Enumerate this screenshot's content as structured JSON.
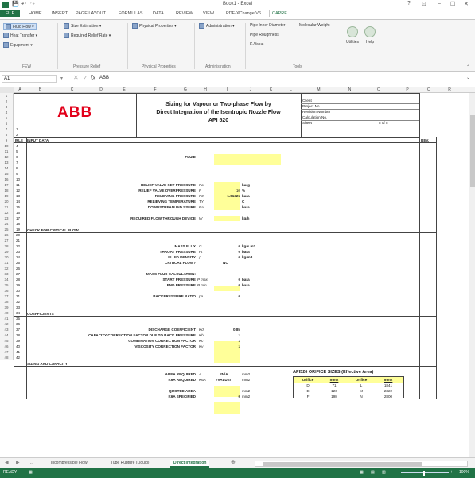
{
  "window": {
    "title": "Book1 - Excel",
    "controls": [
      "?",
      "⊡",
      "–",
      "☐",
      "✕"
    ]
  },
  "ribbon_tabs": [
    "FILE",
    "HOME",
    "INSERT",
    "PAGE LAYOUT",
    "FORMULAS",
    "DATA",
    "REVIEW",
    "VIEW",
    "PDF-XChange V6",
    "CAPRE"
  ],
  "ribbon": {
    "fluid_flow": "Fluid Flow ▾",
    "heat_transfer": "Heat Transfer ▾",
    "equipment": "Equipment ▾",
    "group_few": "FEW",
    "size_estimation": "Size Estimation ▾",
    "required_relief_rate": "Required Relief Rate ▾",
    "group_pressure_relief": "Pressure Relief",
    "physical_properties": "Physical Properties ▾",
    "group_physical_properties": "Physical Properties",
    "administration": "Administration ▾",
    "group_administration": "Administration",
    "pipe_inner_diameter": "Pipe Inner Diameter",
    "molecular_weight": "Molecular Weight",
    "pipe_roughness": "Pipe Roughness",
    "k_value": "K-Value",
    "group_tools": "Tools",
    "utilities": "Utilities",
    "help": "Help"
  },
  "formula_bar": {
    "name_box": "A1",
    "value": "ABB"
  },
  "columns": [
    "A",
    "B",
    "C",
    "D",
    "E",
    "F",
    "G",
    "H",
    "I",
    "J",
    "K",
    "L",
    "M",
    "N",
    "O",
    "P",
    "Q",
    "R"
  ],
  "header_block": {
    "logo": "ABB",
    "title1": "Sizing for Vapour or Two-phase Flow by",
    "title2": "Direct Integration of the Isentropic Nozzle Flow",
    "title3": "API 520",
    "client": "Client",
    "project": "Project No.",
    "revision": "Revision Number",
    "calc": "Calculation No.",
    "sheet": "Sheet",
    "sheet_val": "5 of 5"
  },
  "sheet": {
    "file": "FILE",
    "input_data": "INPUT DATA",
    "rev": "REV.",
    "fluid": "FLUID",
    "relief_set": "RELIEF VALVE SET PRESSURE",
    "relief_over": "RELIEF VALVE OVERPRESSURE",
    "relieving_p": "RELIEVING PRESSURE",
    "relieving_t": "RELIEVING TEMPERATURE",
    "downstream": "DOWNSTREAM IND SSURE",
    "required_flow": "REQUIRED FLOW THROUGH DEVICE",
    "sym_pa": "Pa",
    "sym_p": "P",
    "sym_p0": "P0",
    "sym_t": "TY",
    "sym_pa2": "Pa",
    "sym_w": "W",
    "u_barg": "barg",
    "u_pct": "%",
    "u_bara": "bara",
    "u_c": "C",
    "u_bara2": "bara",
    "u_kgh": "kg/h",
    "v_over": "10",
    "v_relp": "1.01325",
    "critical_flow": "CHECK FOR CRITICAL FLOW",
    "mass_flux": "MASS FLUX",
    "throat_p": "THROAT PRESSURE",
    "fluid_density": "FLUID DENSITY",
    "critical_q": "CRITICAL FLOW?",
    "sym_g": "G",
    "sym_pt": "Pt",
    "sym_rho": "ρ",
    "v_g": "0",
    "v_pt": "0",
    "v_rho": "0",
    "v_crit": "NO",
    "u_kgsm2": "kg/s.m2",
    "u_bara3": "bara",
    "u_kgm3": "kg/m3",
    "mf_calc": "MASS FLUX CALCULATION:",
    "start_p": "START PRESSURE",
    "end_p": "END PRESSURE",
    "sym_pmax": "P max",
    "sym_pmin": "P min",
    "v_pmax": "0",
    "v_pmin": "0",
    "u_bara4": "bara",
    "u_bara5": "bara",
    "bp_ratio": "BACKPRESSURE RATIO",
    "sym_pa3": "pa",
    "v_bp": "0",
    "coefficients": "COEFFICIENTS",
    "discharge": "DISCHARGE COEFFICIENT",
    "cap_corr": "CAPACITY CORRECTION FACTOR DUE TO BACK PRESSURE",
    "comb_corr": "COMBINATION CORRECTION FACTOR",
    "visc_corr": "VISCOSITY CORRECTION FACTOR",
    "sym_kd": "Kd",
    "sym_kb": "Kb",
    "sym_kc": "Kc",
    "sym_kv": "Kv",
    "v_kd": "0.85",
    "v_kb": "1",
    "v_kc": "1",
    "v_kv": "1",
    "sizing": "SIZING AND CAPACITY",
    "area_req": "AREA REQUIRED",
    "k6a_req": "K6A REQUIRED",
    "quoted": "QUOTED AREA",
    "k6a_spec": "K6A SPECIFIED",
    "sym_a": "A",
    "sym_k6a": "K6A",
    "v_areq": "#N/A",
    "v_k6a": "#VALUE!",
    "v_quoted": "",
    "v_k6spec": "0",
    "u_mm2a": "mm2",
    "u_mm2b": "mm2",
    "u_mm2c": "mm2",
    "u_mm2d": "mm2",
    "orifice_title": "API526 ORIFICE SIZES  (Effective Area)",
    "orifice_hdr": [
      "Orifice",
      "mm2",
      "Orifice",
      "mm2"
    ],
    "orifice_rows": [
      [
        "D",
        "71",
        "L",
        "1841"
      ],
      [
        "E",
        "126",
        "M",
        "2322"
      ],
      [
        "F",
        "198",
        "N",
        "2800"
      ]
    ]
  },
  "sheet_tabs": [
    "...",
    "Incompressible Flow",
    "Tube Rupture (Liquid)",
    "Direct Integration"
  ],
  "status": {
    "ready": "READY",
    "zoom": "100%"
  },
  "colors": {
    "excel_green": "#217346",
    "yellow": "#ffff99",
    "abb_red": "#e2001a"
  }
}
